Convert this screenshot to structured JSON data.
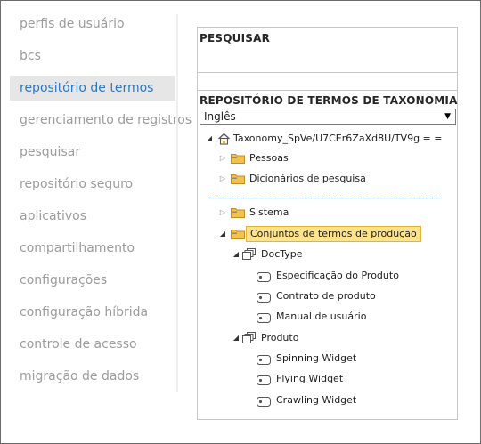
{
  "nav": {
    "items": [
      {
        "label": "perfis de usuário"
      },
      {
        "label": "bcs"
      },
      {
        "label": "repositório de termos"
      },
      {
        "label": "gerenciamento de registros"
      },
      {
        "label": "pesquisar"
      },
      {
        "label": "repositório seguro"
      },
      {
        "label": "aplicativos"
      },
      {
        "label": "compartilhamento"
      },
      {
        "label": "configurações"
      },
      {
        "label": "configuração híbrida"
      },
      {
        "label": "controle de acesso"
      },
      {
        "label": "migração de dados"
      }
    ],
    "selected_index": 2
  },
  "search": {
    "title": "PESQUISAR"
  },
  "taxonomy": {
    "title": "REPOSITÓRIO DE TERMOS DE TAXONOMIA",
    "language": "Inglês",
    "root": "Taxonomy_SpVe/U7CEr6ZaXd8U/TV9g = =",
    "groups": [
      {
        "label": "Pessoas"
      },
      {
        "label": "Dicionários de pesquisa"
      },
      {
        "label": "Sistema"
      },
      {
        "label": "Conjuntos de termos de produção"
      }
    ],
    "term_sets": [
      {
        "label": "DocType",
        "terms": [
          "Especificação do Produto",
          "Contrato de produto",
          "Manual de usuário"
        ]
      },
      {
        "label": "Produto",
        "terms": [
          "Spinning Widget",
          "Flying Widget",
          "Crawling Widget"
        ]
      }
    ]
  },
  "colors": {
    "accent": "#2b78c5",
    "selected_bg": "#e6e6e6",
    "highlight": "#ffe38a",
    "folder": "#f2c14e"
  }
}
